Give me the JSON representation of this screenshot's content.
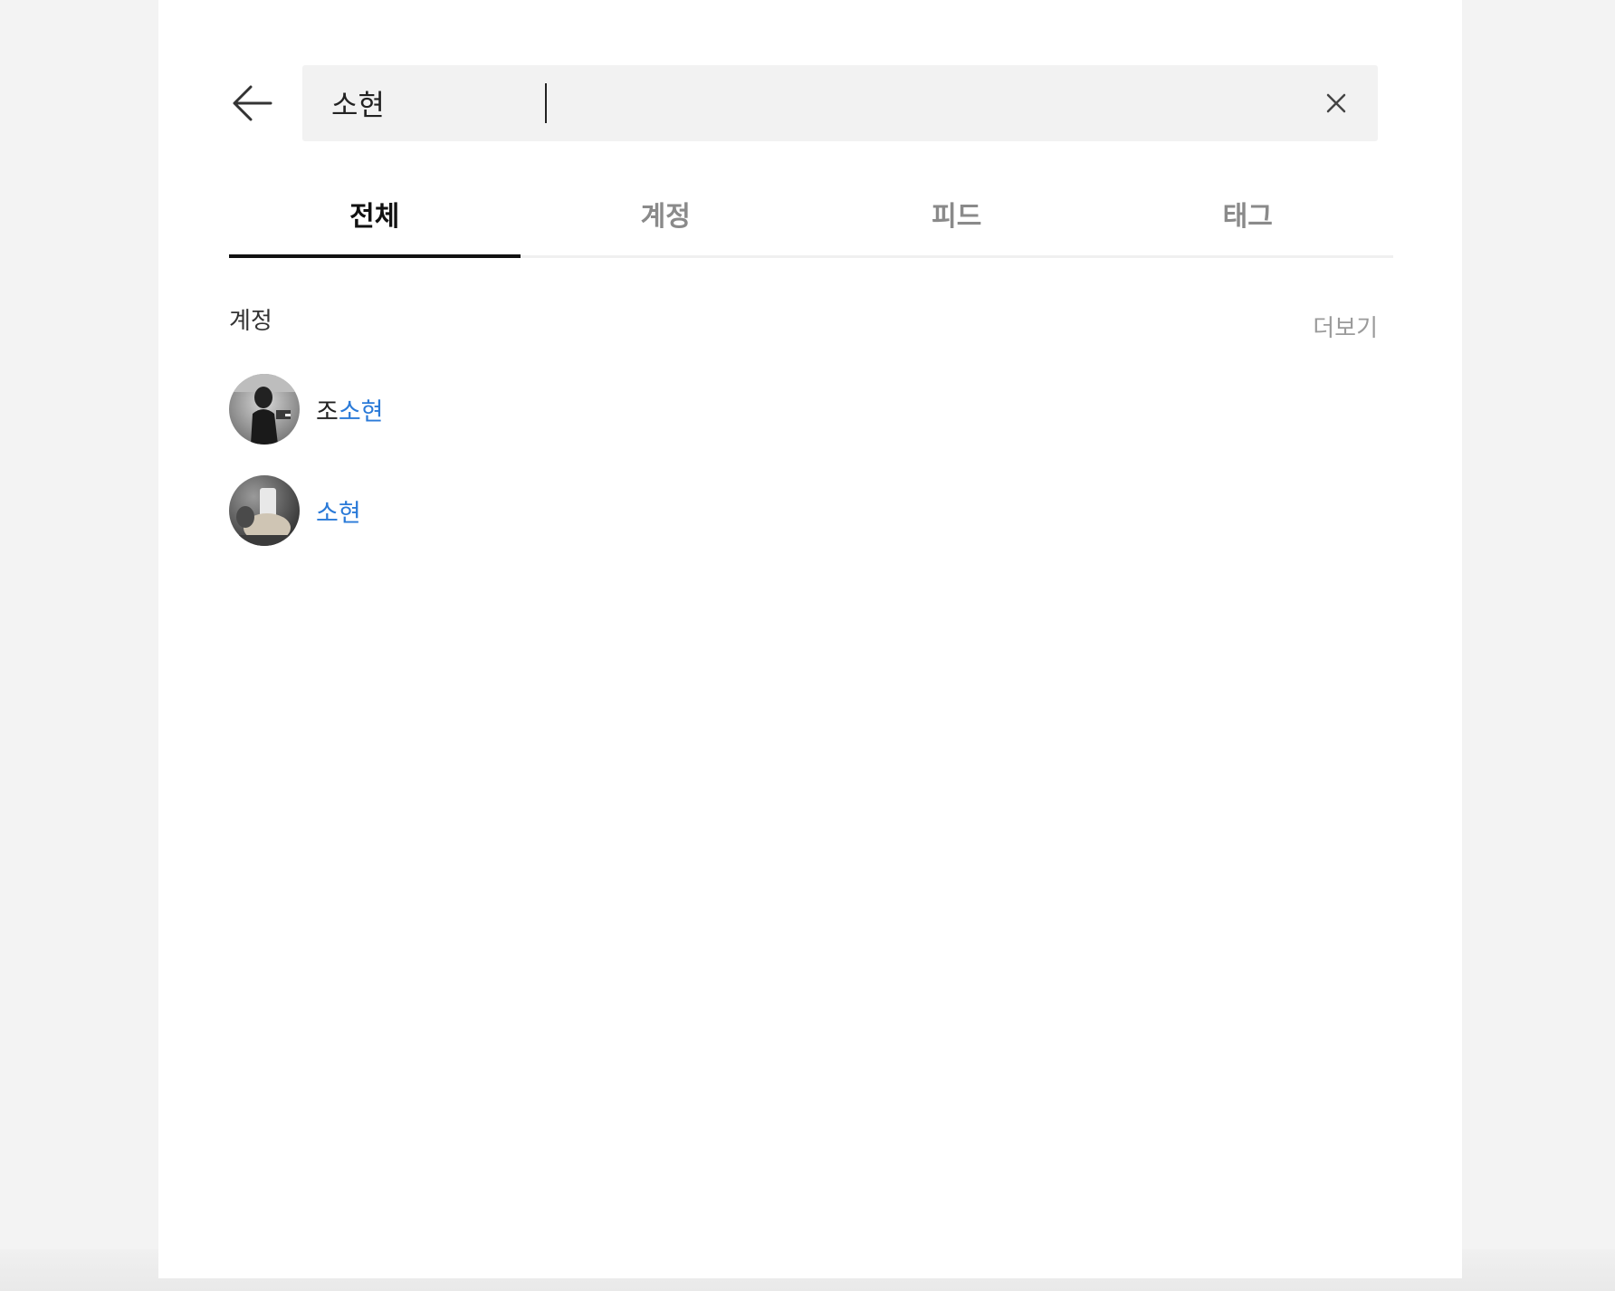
{
  "search": {
    "value": "소현",
    "back_icon": "arrow-left-icon",
    "clear_icon": "close-icon"
  },
  "tabs": [
    {
      "label": "전체",
      "active": true
    },
    {
      "label": "계정",
      "active": false
    },
    {
      "label": "피드",
      "active": false
    },
    {
      "label": "태그",
      "active": false
    }
  ],
  "accounts_section": {
    "title": "계정",
    "more_label": "더보기",
    "items": [
      {
        "prefix": "조",
        "match": "소현",
        "avatar": "avatar-photo"
      },
      {
        "prefix": "",
        "match": "소현",
        "avatar": "avatar-photo"
      }
    ]
  },
  "colors": {
    "highlight": "#2a7ad8",
    "active_tab": "#111111",
    "inactive_tab": "#8a8a8a",
    "search_bg": "#f2f2f2"
  }
}
